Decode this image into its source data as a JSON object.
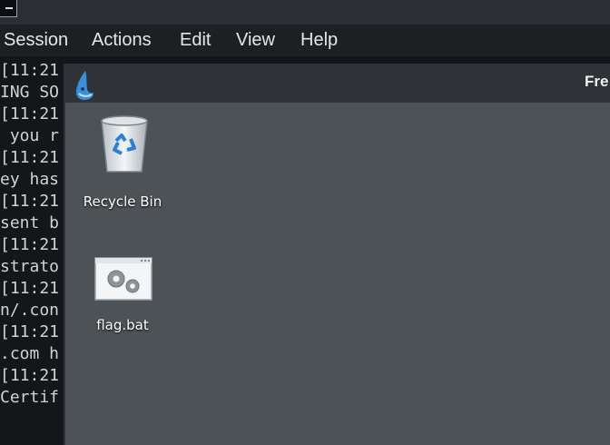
{
  "menubar": {
    "items": [
      {
        "label": "Session"
      },
      {
        "label": "Actions"
      },
      {
        "label": "Edit"
      },
      {
        "label": "View"
      },
      {
        "label": "Help"
      }
    ]
  },
  "terminal": {
    "lines": [
      "[11:21",
      "ING SO",
      "[11:21",
      " you r",
      "[11:21",
      "ey has",
      "[11:21",
      "sent b",
      "[11:21",
      "strato",
      "[11:21",
      "n/.con",
      "[11:21",
      ".com h",
      "[11:21",
      "Certif"
    ]
  },
  "rdp": {
    "title": "Fre",
    "app_icon": "shark-fin-icon"
  },
  "desktop": {
    "icons": [
      {
        "label": "Recycle Bin",
        "icon": "recycle-bin-icon"
      },
      {
        "label": "flag.bat",
        "icon": "batch-file-icon"
      }
    ]
  },
  "colors": {
    "menubar_bg": "#1d2023",
    "terminal_bg": "#151619",
    "desktop_bg": "#4d5256",
    "titlebar_bg": "#2f3338",
    "accent_blue": "#2d7fd6"
  }
}
